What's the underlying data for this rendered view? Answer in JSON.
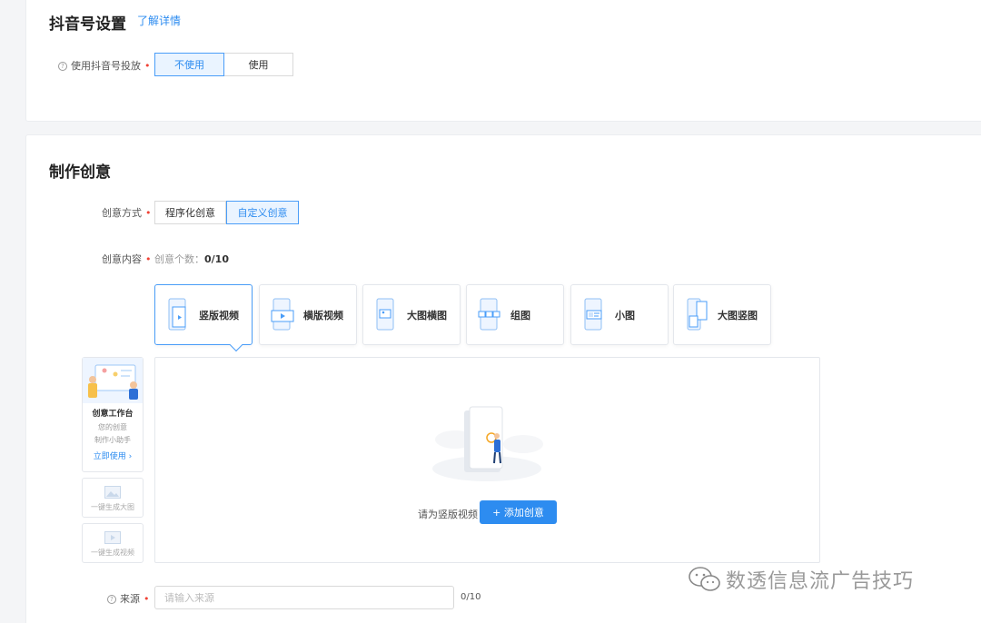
{
  "douyin": {
    "title": "抖音号设置",
    "learn_more": "了解详情",
    "use_label": "使用抖音号投放",
    "options": [
      "不使用",
      "使用"
    ]
  },
  "creative": {
    "title": "制作创意",
    "mode_label": "创意方式",
    "modes": [
      "程序化创意",
      "自定义创意"
    ],
    "content_label": "创意内容",
    "count_label": "创意个数：",
    "count_value": "0/10",
    "types": [
      "竖版视频",
      "横版视频",
      "大图横图",
      "组图",
      "小图",
      "大图竖图"
    ],
    "workbench": {
      "title": "创意工作台",
      "desc1": "您的创意",
      "desc2": "制作小助手",
      "action": "立即使用 ›"
    },
    "gen_image": "一键生成大图",
    "gen_video": "一键生成视频",
    "upload_hint": "请为竖版视频",
    "add_button": "+ 添加创意",
    "source_label": "来源",
    "source_placeholder": "请输入来源",
    "source_count": "0/10"
  },
  "watermark": "数透信息流广告技巧",
  "colors": {
    "accent": "#2d8cf0",
    "required": "#f04134"
  }
}
